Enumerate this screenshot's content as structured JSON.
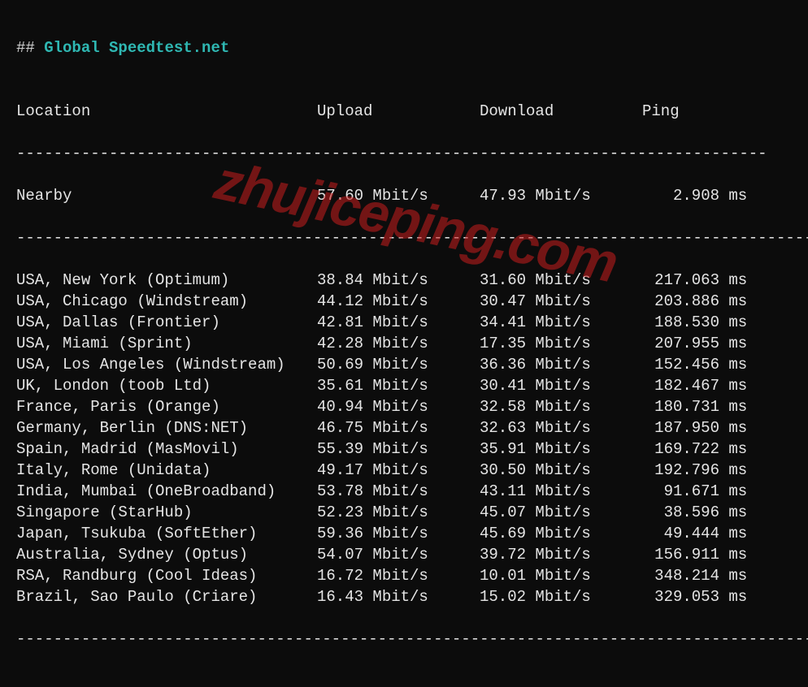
{
  "title_prefix": "## ",
  "title": "Global Speedtest.net",
  "headers": {
    "location": "Location",
    "upload": "Upload",
    "download": "Download",
    "ping": "Ping"
  },
  "dash_lines": {
    "short": "---------------------------------------------------------------------------------",
    "long": "---------------------------------------------------------------------------------------"
  },
  "nearby": {
    "location": "Nearby",
    "upload": "57.60 Mbit/s",
    "download": "47.93 Mbit/s",
    "ping_val": "2.908",
    "ping_unit": " ms"
  },
  "rows": [
    {
      "location": "USA, New York (Optimum)",
      "upload": "38.84 Mbit/s",
      "download": "31.60 Mbit/s",
      "ping_val": "217.063",
      "ping_unit": " ms"
    },
    {
      "location": "USA, Chicago (Windstream)",
      "upload": "44.12 Mbit/s",
      "download": "30.47 Mbit/s",
      "ping_val": "203.886",
      "ping_unit": " ms"
    },
    {
      "location": "USA, Dallas (Frontier)",
      "upload": "42.81 Mbit/s",
      "download": "34.41 Mbit/s",
      "ping_val": "188.530",
      "ping_unit": " ms"
    },
    {
      "location": "USA, Miami (Sprint)",
      "upload": "42.28 Mbit/s",
      "download": "17.35 Mbit/s",
      "ping_val": "207.955",
      "ping_unit": " ms"
    },
    {
      "location": "USA, Los Angeles (Windstream)",
      "upload": "50.69 Mbit/s",
      "download": "36.36 Mbit/s",
      "ping_val": "152.456",
      "ping_unit": " ms"
    },
    {
      "location": "UK, London (toob Ltd)",
      "upload": "35.61 Mbit/s",
      "download": "30.41 Mbit/s",
      "ping_val": "182.467",
      "ping_unit": " ms"
    },
    {
      "location": "France, Paris (Orange)",
      "upload": "40.94 Mbit/s",
      "download": "32.58 Mbit/s",
      "ping_val": "180.731",
      "ping_unit": " ms"
    },
    {
      "location": "Germany, Berlin (DNS:NET)",
      "upload": "46.75 Mbit/s",
      "download": "32.63 Mbit/s",
      "ping_val": "187.950",
      "ping_unit": " ms"
    },
    {
      "location": "Spain, Madrid (MasMovil)",
      "upload": "55.39 Mbit/s",
      "download": "35.91 Mbit/s",
      "ping_val": "169.722",
      "ping_unit": " ms"
    },
    {
      "location": "Italy, Rome (Unidata)",
      "upload": "49.17 Mbit/s",
      "download": "30.50 Mbit/s",
      "ping_val": "192.796",
      "ping_unit": " ms"
    },
    {
      "location": "India, Mumbai (OneBroadband)",
      "upload": "53.78 Mbit/s",
      "download": "43.11 Mbit/s",
      "ping_val": "91.671",
      "ping_unit": " ms"
    },
    {
      "location": "Singapore (StarHub)",
      "upload": "52.23 Mbit/s",
      "download": "45.07 Mbit/s",
      "ping_val": "38.596",
      "ping_unit": " ms"
    },
    {
      "location": "Japan, Tsukuba (SoftEther)",
      "upload": "59.36 Mbit/s",
      "download": "45.69 Mbit/s",
      "ping_val": "49.444",
      "ping_unit": " ms"
    },
    {
      "location": "Australia, Sydney (Optus)",
      "upload": "54.07 Mbit/s",
      "download": "39.72 Mbit/s",
      "ping_val": "156.911",
      "ping_unit": " ms"
    },
    {
      "location": "RSA, Randburg (Cool Ideas)",
      "upload": "16.72 Mbit/s",
      "download": "10.01 Mbit/s",
      "ping_val": "348.214",
      "ping_unit": " ms"
    },
    {
      "location": "Brazil, Sao Paulo (Criare)",
      "upload": "16.43 Mbit/s",
      "download": "15.02 Mbit/s",
      "ping_val": "329.053",
      "ping_unit": " ms"
    }
  ],
  "watermark": "zhujiceping.com"
}
